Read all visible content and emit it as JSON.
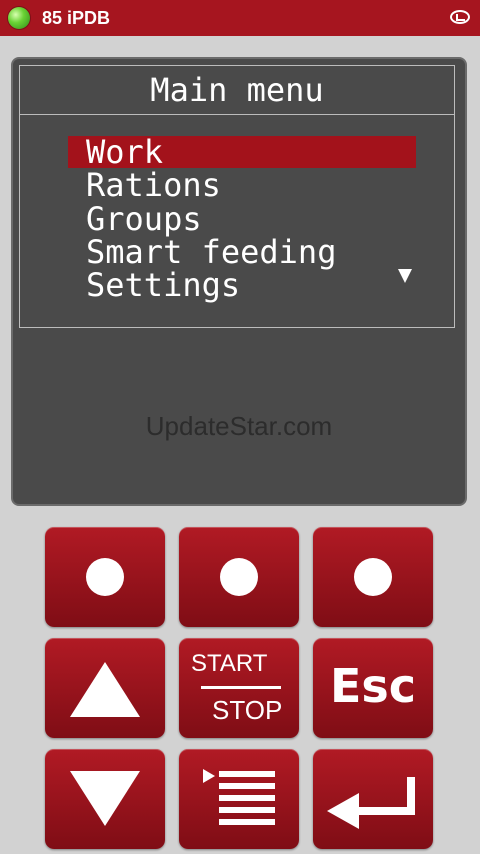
{
  "status_bar": {
    "title": "85 iPDB",
    "indicator": "green-led-icon",
    "logo": "brand-logo-icon"
  },
  "screen": {
    "title": "Main menu",
    "menu_items": [
      {
        "label": "Work",
        "selected": true
      },
      {
        "label": "Rations",
        "selected": false
      },
      {
        "label": "Groups",
        "selected": false
      },
      {
        "label": "Smart feeding",
        "selected": false
      },
      {
        "label": "Settings",
        "selected": false
      }
    ],
    "scroll_indicator": "triangle-down-icon",
    "watermark": "UpdateStar.com"
  },
  "keypad": {
    "soft_keys": [
      "soft-key-left",
      "soft-key-middle",
      "soft-key-right"
    ],
    "start_label": "START",
    "stop_label": "STOP",
    "esc_label": "Esc",
    "icons": [
      "up-arrow-icon",
      "down-arrow-icon",
      "menu-list-icon",
      "enter-icon"
    ]
  },
  "colors": {
    "accent_red": "#a3121b",
    "status_bar": "#a6151f",
    "screen_bg": "#4a4a4a",
    "page_bg": "#d2d2d2"
  }
}
